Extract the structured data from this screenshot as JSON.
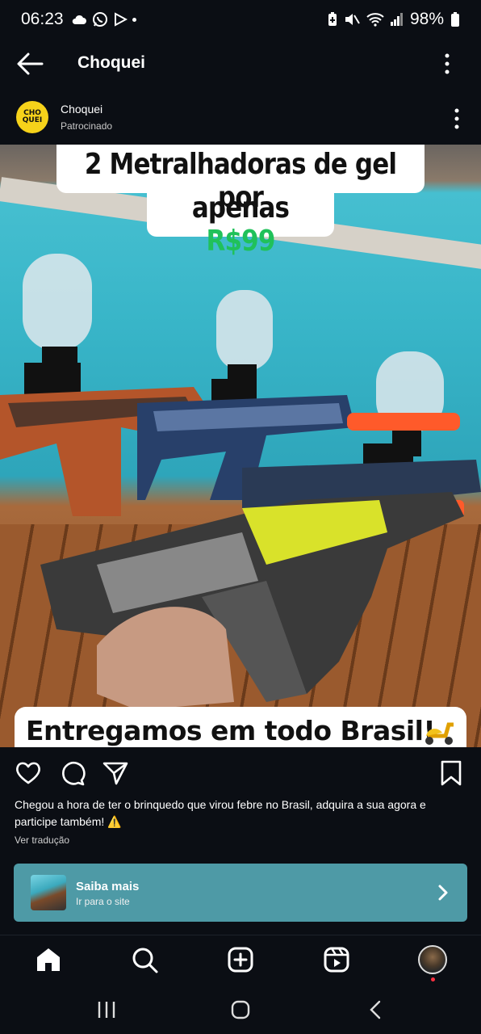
{
  "status_bar": {
    "time": "06:23",
    "battery": "98%",
    "left_icons": [
      "cloud-icon",
      "whatsapp-icon",
      "play-store-icon",
      "dot-icon"
    ],
    "right_icons": [
      "battery-saver-icon",
      "mute-icon",
      "wifi-icon",
      "signal-icon",
      "battery-icon"
    ]
  },
  "header": {
    "title": "Choquei",
    "icons": [
      "back-arrow-icon",
      "more-vertical-icon"
    ]
  },
  "post": {
    "account_name": "Choquei",
    "account_subtitle": "Patrocinado",
    "logo_text": "CHO QUEI",
    "image": {
      "headline_line1": "2 Metralhadoras de gel por",
      "headline_line2_prefix": "apenas ",
      "headline_price": "R$99",
      "footer_text": "Entregamos em todo Brasil!",
      "accent_price_color": "#20c15a"
    },
    "actions": [
      "heart-icon",
      "comment-icon",
      "share-icon",
      "bookmark-icon"
    ],
    "caption": "Chegou a hora de ter o brinquedo que virou febre no Brasil, adquira a sua agora e participe também! ⚠️",
    "translate_label": "Ver tradução",
    "cta": {
      "title": "Saiba mais",
      "subtitle": "Ir para o site",
      "color": "#4e9aa6"
    }
  },
  "bottom_nav": [
    "home-icon",
    "search-icon",
    "create-icon",
    "reels-icon",
    "profile-avatar"
  ],
  "system_nav": [
    "recents-icon",
    "home-circle-icon",
    "back-icon"
  ]
}
